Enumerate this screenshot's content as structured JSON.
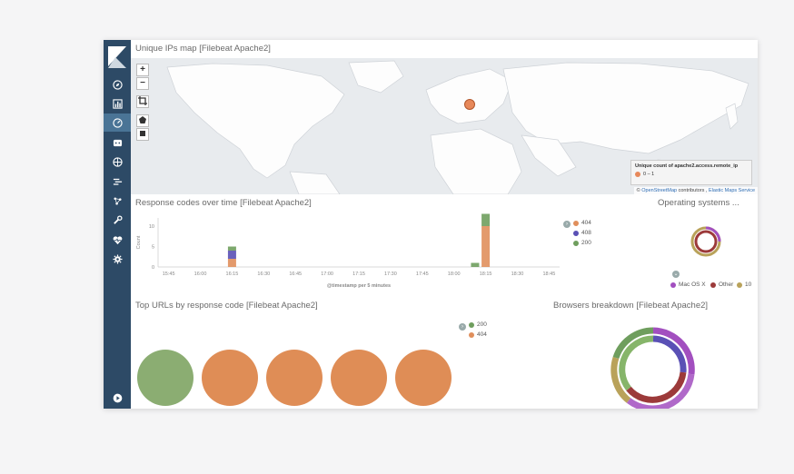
{
  "sidebar": {
    "items": [
      {
        "name": "discover-icon"
      },
      {
        "name": "visualize-icon"
      },
      {
        "name": "dashboard-icon"
      },
      {
        "name": "canvas-icon"
      },
      {
        "name": "maps-icon"
      },
      {
        "name": "logs-icon"
      },
      {
        "name": "apm-icon"
      },
      {
        "name": "dev-tools-icon"
      },
      {
        "name": "monitoring-icon"
      },
      {
        "name": "management-icon"
      }
    ],
    "bottom": "play-icon"
  },
  "map_panel": {
    "title": "Unique IPs map [Filebeat Apache2]",
    "zoom_in": "+",
    "zoom_out": "−",
    "legend_title": "Unique count of apache2.access.remote_ip",
    "legend_range": "0 – 1",
    "attribution_prefix": "© ",
    "attribution_osm": "OpenStreetMap",
    "attribution_mid": " contributors , ",
    "attribution_ems": "Elastic Maps Service",
    "marker_color": "#e7885a"
  },
  "response_panel": {
    "title": "Response codes over time [Filebeat Apache2]",
    "legend": [
      {
        "label": "404",
        "color": "#e08f5c"
      },
      {
        "label": "408",
        "color": "#5a50b5"
      },
      {
        "label": "200",
        "color": "#6f9e5e"
      }
    ]
  },
  "chart_data": {
    "type": "bar",
    "ylabel": "Count",
    "xlabel": "@timestamp per 5 minutes",
    "y_ticks": [
      0,
      5,
      10
    ],
    "ylim": [
      0,
      12
    ],
    "x_ticks": [
      "15:45",
      "16:00",
      "16:15",
      "16:30",
      "16:45",
      "17:00",
      "17:15",
      "17:30",
      "17:45",
      "18:00",
      "18:15",
      "18:30",
      "18:45"
    ],
    "bars": [
      {
        "time": "16:15",
        "segments": [
          {
            "series": "404",
            "value": 2
          },
          {
            "series": "408",
            "value": 2
          },
          {
            "series": "200",
            "value": 1
          }
        ]
      },
      {
        "time": "18:10",
        "segments": [
          {
            "series": "200",
            "value": 1
          }
        ]
      },
      {
        "time": "18:15",
        "segments": [
          {
            "series": "404",
            "value": 10
          },
          {
            "series": "200",
            "value": 3
          }
        ]
      }
    ]
  },
  "os_panel": {
    "title": "Operating systems ...",
    "legend": [
      {
        "label": "Mac OS X",
        "color": "#a24fbf"
      },
      {
        "label": "Other",
        "color": "#9c3a3a"
      },
      {
        "label": "10",
        "color": "#b9a25a"
      }
    ]
  },
  "urls_panel": {
    "title": "Top URLs by response code [Filebeat Apache2]",
    "legend": [
      {
        "label": "200",
        "color": "#6f9e5e"
      },
      {
        "label": "404",
        "color": "#e08f5c"
      }
    ],
    "circles": [
      {
        "code": "200",
        "color": "#8bad72"
      },
      {
        "code": "404",
        "color": "#df8d56"
      },
      {
        "code": "404",
        "color": "#df8d56"
      },
      {
        "code": "404",
        "color": "#df8d56"
      },
      {
        "code": "404",
        "color": "#df8d56"
      }
    ]
  },
  "browsers_panel": {
    "title": "Browsers breakdown [Filebeat Apache2]"
  }
}
